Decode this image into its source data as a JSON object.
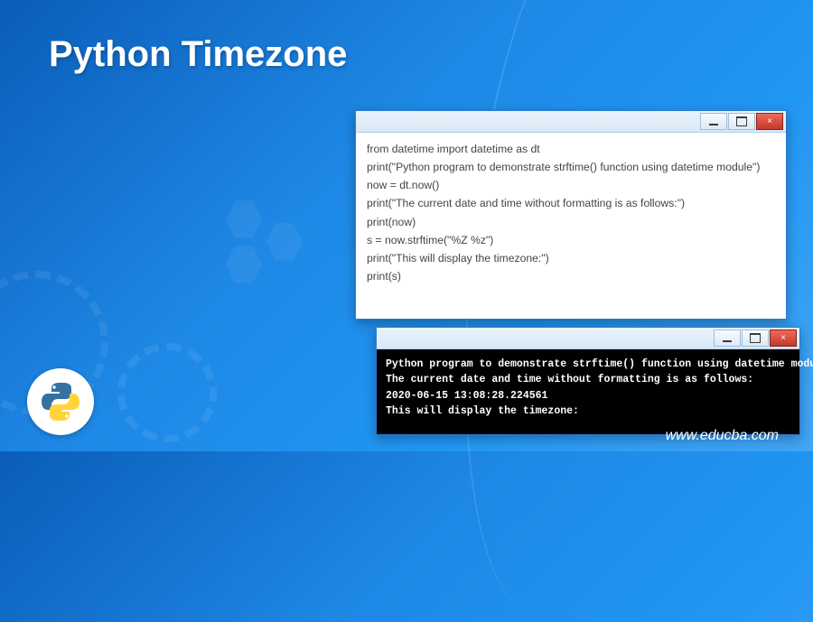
{
  "page": {
    "title": "Python Timezone",
    "footer": "www.educba.com"
  },
  "logo": {
    "name": "python-logo"
  },
  "code_window": {
    "lines": [
      "from datetime import datetime as dt",
      "print(\"Python program to demonstrate strftime() function using datetime module\")",
      "now = dt.now()",
      "print(\"The current date and time without formatting is as follows:\")",
      "print(now)",
      "s = now.strftime(\"%Z %z\")",
      "print(\"This will display the timezone:\")",
      "print(s)"
    ],
    "buttons": {
      "min": "minimize",
      "max": "maximize",
      "close": "×"
    }
  },
  "terminal_window": {
    "lines": [
      "Python program to demonstrate strftime() function using datetime module",
      "The current date and time without formatting is as follows:",
      "2020-06-15 13:08:28.224561",
      "This will display the timezone:"
    ],
    "buttons": {
      "min": "minimize",
      "max": "maximize",
      "close": "×"
    }
  }
}
